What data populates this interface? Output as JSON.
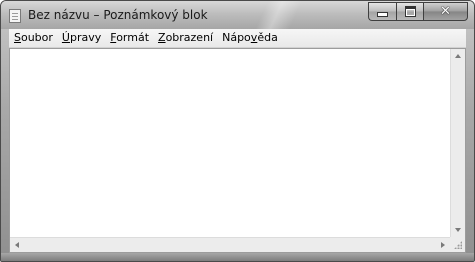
{
  "window": {
    "title": "Bez názvu – Poznámkový blok",
    "frame_color": "#a9a9a9",
    "close_color": "#858585"
  },
  "titlebar": {
    "icon": "notepad-icon",
    "controls": {
      "minimize_icon": "minimize-icon",
      "maximize_icon": "maximize-icon",
      "close_icon": "close-icon",
      "close_glyph": "✕"
    }
  },
  "menubar": {
    "items": [
      {
        "label_pre": "",
        "label_key": "S",
        "label_post": "oubor"
      },
      {
        "label_pre": "",
        "label_key": "Ú",
        "label_post": "pravy"
      },
      {
        "label_pre": "",
        "label_key": "F",
        "label_post": "ormát"
      },
      {
        "label_pre": "",
        "label_key": "Z",
        "label_post": "obrazení"
      },
      {
        "label_pre": "Nápo",
        "label_key": "v",
        "label_post": "ěda"
      }
    ]
  },
  "editor": {
    "text": "",
    "background": "#ffffff"
  },
  "scrollbars": {
    "vertical_up_icon": "scroll-up-arrow-icon",
    "vertical_down_icon": "scroll-down-arrow-icon",
    "horizontal_left_icon": "scroll-left-arrow-icon",
    "horizontal_right_icon": "scroll-right-arrow-icon",
    "grip_icon": "size-grip-icon"
  }
}
